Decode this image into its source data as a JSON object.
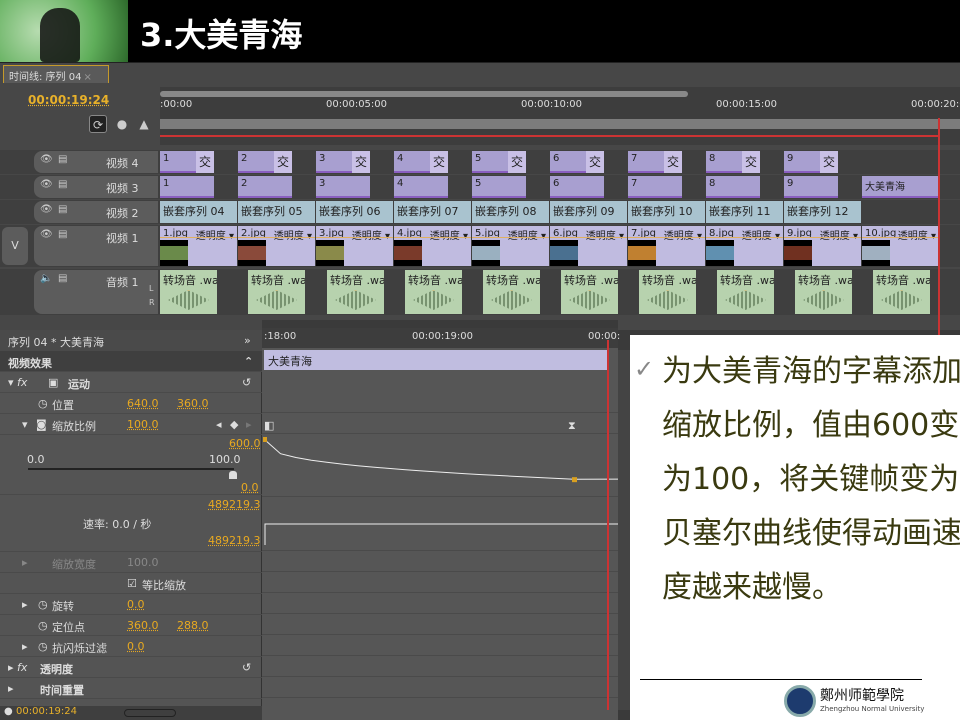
{
  "slide": {
    "title": "3.大美青海",
    "bullet": "为大美青海的字幕添加缩放比例，值由600变为100，将关键帧变为贝塞尔曲线使得动画速度越来越慢。",
    "logo_text": "鄭州师範學院",
    "logo_sub": "Zhengzhou Normal University"
  },
  "timeline": {
    "tab": "时间线: 序列 04",
    "timecode": "00:00:19:24",
    "ruler": [
      ":00:00",
      "00:00:05:00",
      "00:00:10:00",
      "00:00:15:00",
      "00:00:20:0"
    ],
    "tracks": {
      "v4": "视频 4",
      "v3": "视频 3",
      "v2": "视频 2",
      "v1": "视频 1",
      "a1": "音频 1",
      "v_target": "V"
    },
    "v4_clips": [
      "1",
      "2",
      "3",
      "4",
      "5",
      "6",
      "7",
      "8",
      "9"
    ],
    "transition": "交",
    "v3_clips": [
      "1",
      "2",
      "3",
      "4",
      "5",
      "6",
      "7",
      "8",
      "9",
      "大美青海"
    ],
    "v2_clips": [
      "嵌套序列 04",
      "嵌套序列 05",
      "嵌套序列 06",
      "嵌套序列 07",
      "嵌套序列 08",
      "嵌套序列 09",
      "嵌套序列 10",
      "嵌套序列 11",
      "嵌套序列 12"
    ],
    "v1_clips": [
      "1.jpg",
      "2.jpg",
      "3.jpg",
      "4.jpg",
      "5.jpg",
      "6.jpg",
      "7.jpg",
      "8.jpg",
      "9.jpg",
      "10.jpg"
    ],
    "opacity": "透明度",
    "a1_clip": "转场音 .wa",
    "a1_count": 10,
    "lr": [
      "L",
      "R"
    ]
  },
  "effects": {
    "header": "序列 04 * 大美青海",
    "section": "视频效果",
    "motion": "运动",
    "position": {
      "label": "位置",
      "x": "640.0",
      "y": "360.0"
    },
    "scale": {
      "label": "缩放比例",
      "value": "100.0",
      "max_value": "600.0",
      "slider_min": "0.0",
      "slider_max": "100.0",
      "min_value": "0.0",
      "vel_top": "489219.3",
      "vel_bottom": "489219.3",
      "velocity": "速率: 0.0 / 秒"
    },
    "scale_width": {
      "label": "缩放宽度",
      "value": "100.0"
    },
    "uniform": "等比缩放",
    "rotation": {
      "label": "旋转",
      "value": "0.0"
    },
    "anchor": {
      "label": "定位点",
      "x": "360.0",
      "y": "288.0"
    },
    "flicker": {
      "label": "抗闪烁过滤",
      "value": "0.0"
    },
    "opacity": "透明度",
    "time_remap": "时间重置",
    "timecode": "00:00:19:24"
  },
  "keyframes": {
    "ruler": [
      ":18:00",
      "00:00:19:00",
      "00:00:"
    ],
    "clip": "大美青海",
    "start_value": 600,
    "end_value": 100
  }
}
